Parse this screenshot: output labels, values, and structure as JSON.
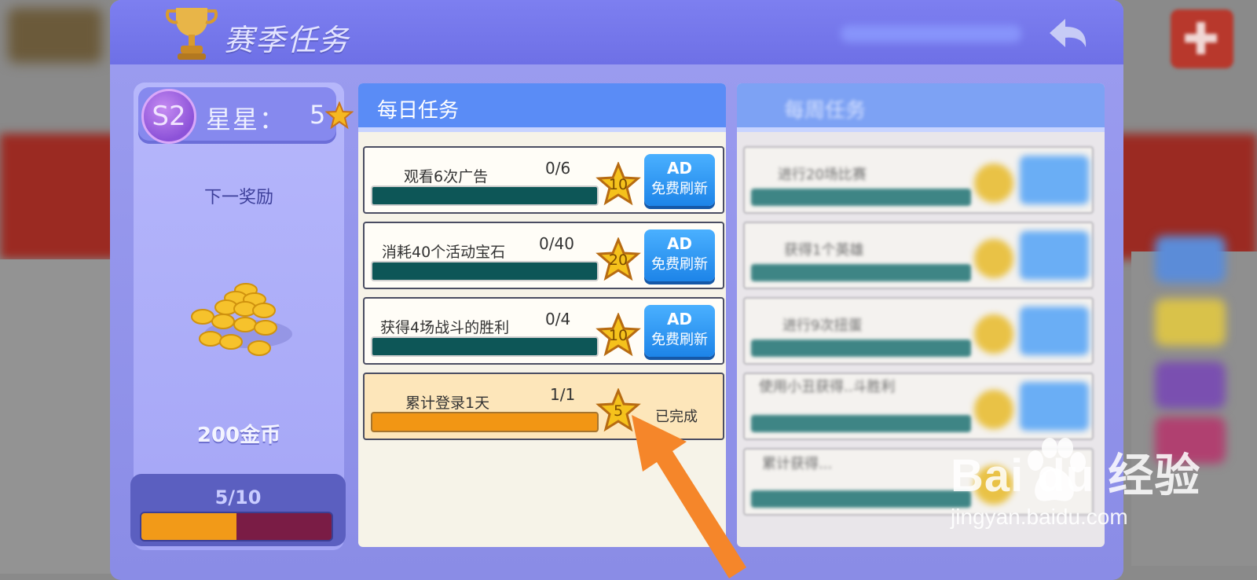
{
  "modal": {
    "title": "赛季任务"
  },
  "season": {
    "badge": "S2",
    "stars_label": "星星：",
    "stars_value": "5",
    "next_reward_label": "下一奖励",
    "reward_name": "200金币",
    "progress_text": "5/10",
    "progress_fraction": 0.5
  },
  "daily": {
    "title": "每日任务",
    "tasks": [
      {
        "name": "观看6次广告",
        "count": "0/6",
        "stars": "10",
        "ad_label": "AD",
        "ad_sub": "免费刷新"
      },
      {
        "name": "消耗40个活动宝石",
        "count": "0/40",
        "stars": "20",
        "ad_label": "AD",
        "ad_sub": "免费刷新"
      },
      {
        "name": "获得4场战斗的胜利",
        "count": "0/4",
        "stars": "10",
        "ad_label": "AD",
        "ad_sub": "免费刷新"
      },
      {
        "name": "累计登录1天",
        "count": "1/1",
        "stars": "5",
        "status": "已完成"
      }
    ]
  },
  "weekly": {
    "title": "每周任务",
    "tasks": [
      {
        "name": "进行20场比赛"
      },
      {
        "name": "获得1个英雄"
      },
      {
        "name": "进行9次扭蛋"
      },
      {
        "name": "使用小丑获得..斗胜利"
      },
      {
        "name": "累计获得..."
      }
    ]
  },
  "watermark": {
    "logo": "Bai du 经验",
    "url": "jingyan.baidu.com"
  },
  "colors": {
    "accent_blue": "#5a8cf6",
    "progress_orange": "#f29a18",
    "task_bar_teal": "#0d5657",
    "arrow_orange": "#f5862a"
  }
}
